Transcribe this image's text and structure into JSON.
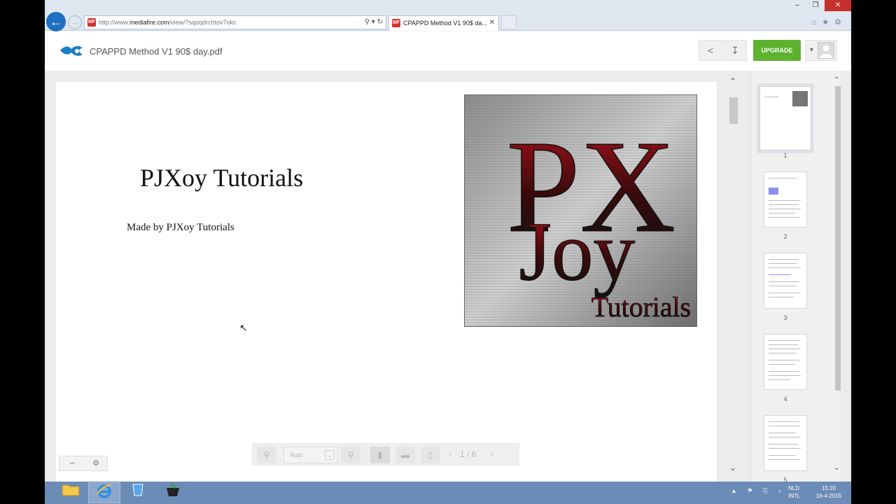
{
  "browser": {
    "url_prefix": "http://www.",
    "url_domain": "mediafire.com",
    "url_rest": "/view/?sqoqdrchtov7okc",
    "tab_title": "CPAPPD Method V1 90$ da...",
    "favicon_text": "MF"
  },
  "header": {
    "doc_title": "CPAPPD Method V1 90$ day.pdf",
    "upgrade_label": "UPGRADE"
  },
  "pdf": {
    "title": "PJXoy Tutorials",
    "subtitle": "Made by PJXoy Tutorials",
    "logo_text": {
      "big": "PX",
      "mid": "Joy",
      "small": "Tutorials"
    }
  },
  "thumbnails": [
    {
      "label": "1"
    },
    {
      "label": "2"
    },
    {
      "label": "3"
    },
    {
      "label": "4"
    },
    {
      "label": "5"
    }
  ],
  "toolbar": {
    "zoom_value": "Auto",
    "page_indicator": "1 / 6"
  },
  "taskbar": {
    "lang_line1": "NLD",
    "lang_line2": "INTL",
    "time": "15:20",
    "date": "16-4-2015"
  },
  "colors": {
    "accent": "#5db22e",
    "ie_blue": "#1f6fc3",
    "taskbar": "#6b8cb6"
  },
  "icons": [
    "back-arrow-icon",
    "forward-arrow-icon",
    "search-icon",
    "refresh-icon",
    "close-icon",
    "home-icon",
    "star-icon",
    "gear-icon",
    "share-icon",
    "download-icon",
    "user-icon",
    "zoom-out-icon",
    "zoom-in-icon",
    "chevron-left-icon",
    "chevron-right-icon",
    "folder-icon",
    "ie-icon"
  ]
}
